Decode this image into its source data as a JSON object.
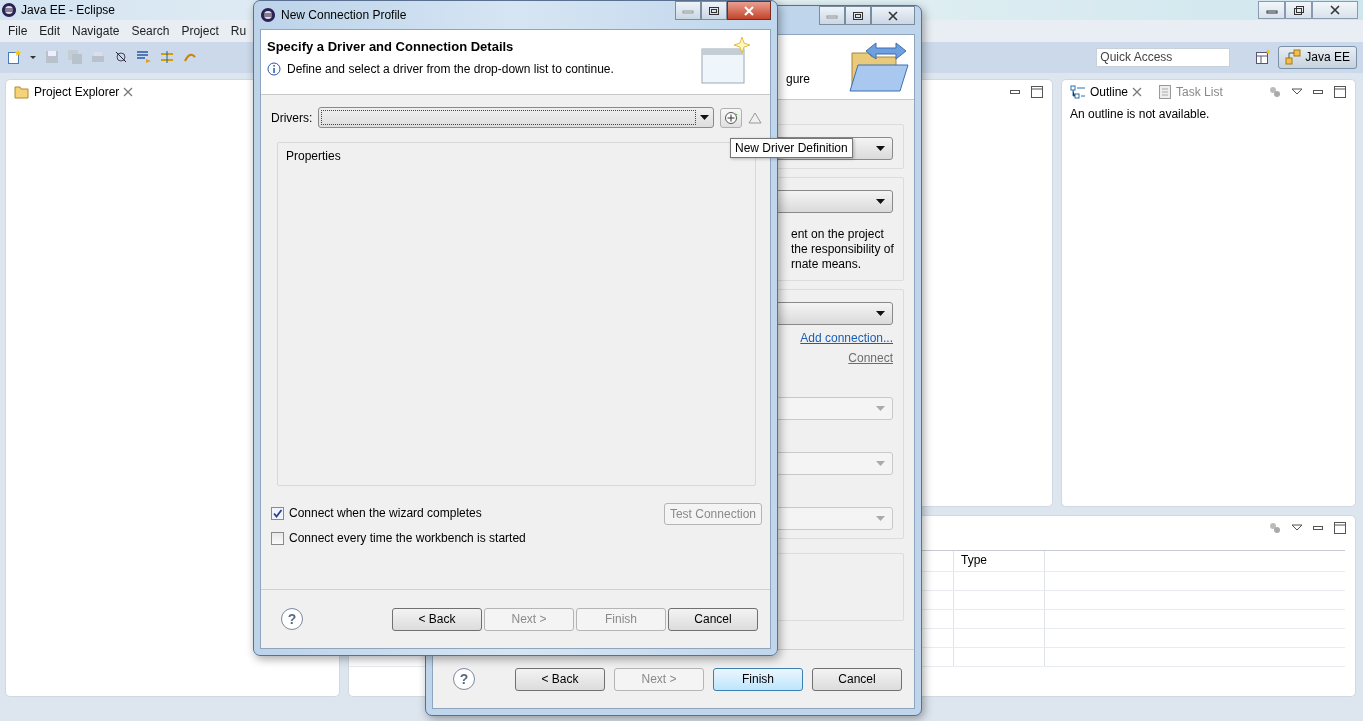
{
  "main_window": {
    "title": "Java EE - Eclipse",
    "menu": [
      "File",
      "Edit",
      "Navigate",
      "Search",
      "Project",
      "Ru"
    ],
    "quick_access": {
      "placeholder": "Quick Access"
    },
    "perspective": {
      "label": "Java EE",
      "selected": true
    }
  },
  "project_explorer": {
    "title": "Project Explorer"
  },
  "outline": {
    "tabs": [
      {
        "label": "Outline",
        "selected": true
      },
      {
        "label": "Task List",
        "selected": false
      }
    ],
    "message": "An outline is not available."
  },
  "bottom_panel": {
    "columns": [
      "Type"
    ]
  },
  "background_dialog": {
    "header_fragment": "gure",
    "groups": [
      {
        "combos": [
          {
            "disabled": false
          }
        ]
      },
      {
        "combos": [
          {
            "disabled": false
          }
        ],
        "lines": [
          "ent on the project",
          "the responsibility of",
          "rnate means."
        ]
      },
      {
        "combos": [
          {
            "disabled": false
          }
        ],
        "links": [
          {
            "label": "Add connection...",
            "disabled": false
          },
          {
            "label": "Connect",
            "disabled": true
          }
        ],
        "more_combos": [
          {
            "disabled": true
          },
          {
            "disabled": true
          },
          {
            "disabled": true
          }
        ]
      }
    ],
    "help": "?",
    "buttons": [
      {
        "label": "< Back",
        "disabled": false,
        "default": false
      },
      {
        "label": "Next >",
        "disabled": true,
        "default": false
      },
      {
        "label": "Finish",
        "disabled": false,
        "default": true
      },
      {
        "label": "Cancel",
        "disabled": false,
        "default": false
      }
    ]
  },
  "dialog": {
    "title": "New Connection Profile",
    "heading": "Specify a Driver and Connection Details",
    "message": "Define and select a driver from the drop-down list to continue.",
    "drivers_label": "Drivers:",
    "tooltip": "New Driver Definition",
    "properties_label": "Properties",
    "options": [
      {
        "label": "Connect when the wizard completes",
        "checked": true
      },
      {
        "label": "Connect every time the workbench is started",
        "checked": false
      }
    ],
    "test_connection": {
      "label": "Test Connection",
      "disabled": true
    },
    "help": "?",
    "buttons": [
      {
        "label": "< Back",
        "disabled": false
      },
      {
        "label": "Next >",
        "disabled": true
      },
      {
        "label": "Finish",
        "disabled": true
      },
      {
        "label": "Cancel",
        "disabled": false
      }
    ]
  }
}
